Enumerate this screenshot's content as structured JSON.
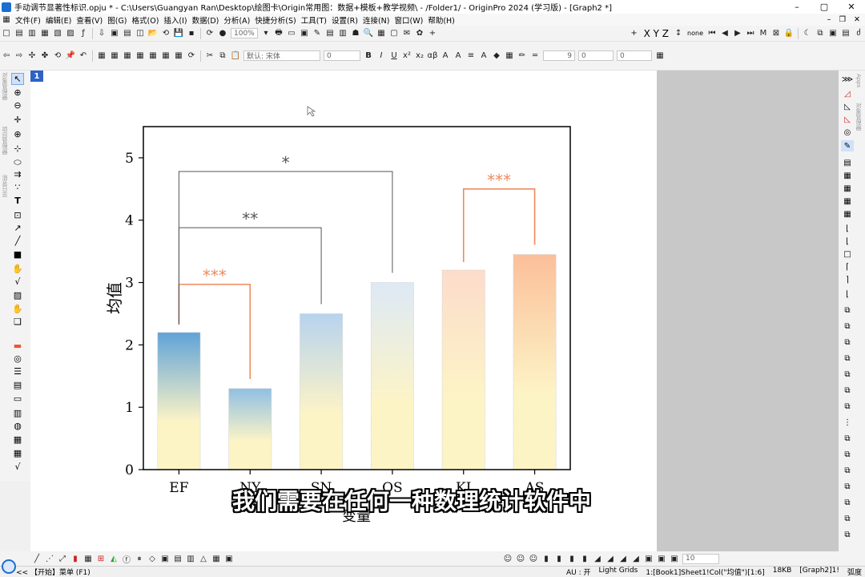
{
  "window": {
    "title": "手动调节显著性标识.opju * - C:\\Users\\Guangyan Ran\\Desktop\\绘图卡\\Origin常用图：数据+模板+教学视频\\ - /Folder1/ - OriginPro 2024 (学习版) - [Graph2 *]",
    "minimize": "–",
    "maximize": "▢",
    "close": "✕"
  },
  "menu": [
    "文件(F)",
    "编辑(E)",
    "查看(V)",
    "图(G)",
    "格式(O)",
    "插入(I)",
    "数据(D)",
    "分析(A)",
    "快捷分析(S)",
    "工具(T)",
    "设置(R)",
    "连接(N)",
    "窗口(W)",
    "帮助(H)"
  ],
  "toolbar": {
    "zoom": "100%",
    "xyz_label": "X Y Z",
    "none_label": "none",
    "font_name": "默认: 宋体",
    "font_size": "0",
    "line_width": "9",
    "spin1": "0",
    "spin2": "0",
    "bottom_combo": "10"
  },
  "page": {
    "tab_label": "1"
  },
  "subtitle": "我们需要在任何一种数理统计软件中",
  "status": {
    "left": "<< 【开始】菜单 (F1)",
    "au": "AU : 开",
    "grids": "Light Grids",
    "col": "1:[Book1]Sheet1!Col(\"均值\")[1:6]",
    "size": "18KB",
    "graph": "[Graph2]1!",
    "rad": "弧度"
  },
  "colors": {
    "bracket_orange": "#f08a5d",
    "bracket_gray": "#555555",
    "tab_blue": "#2d62c8"
  },
  "chart_data": {
    "type": "bar",
    "categories": [
      "EF",
      "NY",
      "SN",
      "OS",
      "KI",
      "AS"
    ],
    "values": [
      2.2,
      1.3,
      2.5,
      3.0,
      3.2,
      3.45
    ],
    "ylabel": "均值",
    "xlabel": "变量",
    "ylim": [
      0,
      5.5
    ],
    "yticks": [
      0,
      1,
      2,
      3,
      4,
      5
    ],
    "bar_gradients": [
      [
        "#5fa3d8",
        "#fdf4c6"
      ],
      [
        "#90c0e3",
        "#fdf4c6"
      ],
      [
        "#b7d3ee",
        "#fdf4c6"
      ],
      [
        "#dde9f6",
        "#fdf4c6"
      ],
      [
        "#fcdccb",
        "#fdf4c6"
      ],
      [
        "#fbbf9a",
        "#fdf4c6"
      ]
    ],
    "annotations": [
      {
        "from": 0,
        "to": 1,
        "label": "***",
        "level": 2.97,
        "color": "#f08a5d"
      },
      {
        "from": 0,
        "to": 2,
        "label": "**",
        "level": 3.88,
        "color": "#555555"
      },
      {
        "from": 0,
        "to": 3,
        "label": "*",
        "level": 4.78,
        "color": "#555555"
      },
      {
        "from": 4,
        "to": 5,
        "label": "***",
        "level": 4.5,
        "color": "#f08a5d"
      }
    ]
  }
}
